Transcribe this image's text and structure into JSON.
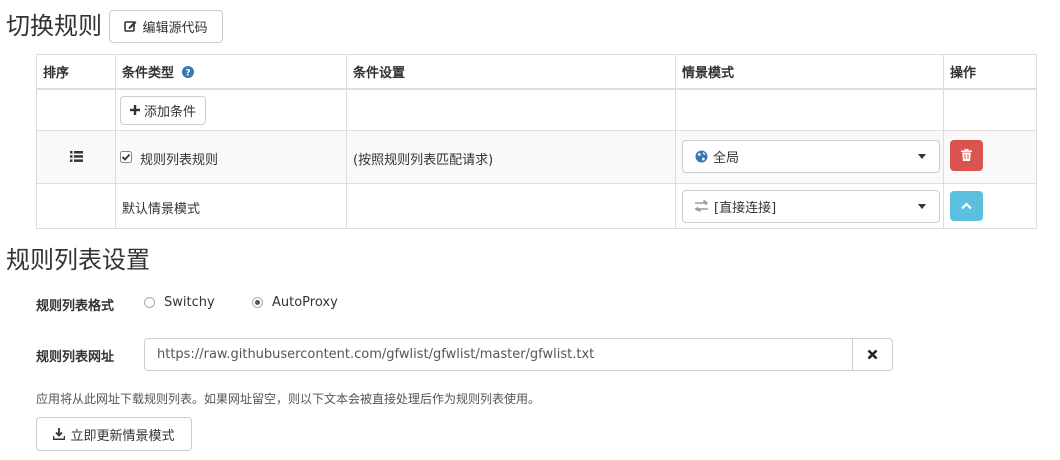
{
  "section1": {
    "title": "切换规则",
    "edit_source_label": "编辑源代码"
  },
  "table": {
    "headers": {
      "order": "排序",
      "condition_type": "条件类型",
      "condition_settings": "条件设置",
      "profile": "情景模式",
      "action": "操作"
    },
    "add_condition_label": "添加条件",
    "rule_row": {
      "checked": true,
      "type_label": "规则列表规则",
      "settings": "(按照规则列表匹配请求)",
      "profile": "全局"
    },
    "default_row": {
      "label": "默认情景模式",
      "profile": "[直接连接]"
    }
  },
  "section2": {
    "title": "规则列表设置",
    "format_label": "规则列表格式",
    "format_options": [
      "Switchy",
      "AutoProxy"
    ],
    "format_selected": "AutoProxy",
    "url_label": "规则列表网址",
    "url_value": "https://raw.githubusercontent.com/gfwlist/gfwlist/master/gfwlist.txt",
    "help_text": "应用将从此网址下载规则列表。如果网址留空，则以下文本会被直接处理后作为规则列表使用。",
    "update_button_label": "立即更新情景模式"
  },
  "colors": {
    "delete_button": "#d9534f",
    "up_button": "#5bc0de",
    "help_icon": "#337ab7",
    "globe_icon": "#337ab7"
  },
  "icons": {
    "edit": "edit-icon",
    "help": "help-icon",
    "plus": "plus-icon",
    "list": "list-icon",
    "globe": "globe-icon",
    "trash": "trash-icon",
    "exchange": "exchange-icon",
    "chevron_up": "chevron-up-icon",
    "clear": "clear-icon",
    "download": "download-icon"
  }
}
